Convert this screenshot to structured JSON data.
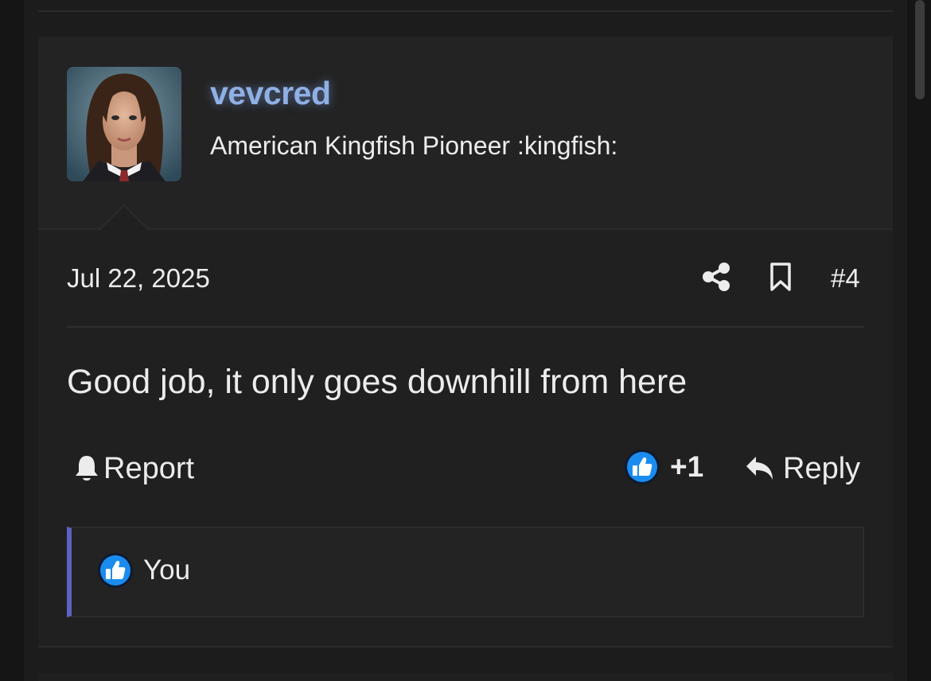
{
  "post": {
    "user": {
      "name": "vevcred",
      "title": "American Kingfish Pioneer :kingfish:"
    },
    "date": "Jul 22, 2025",
    "number": "#4",
    "body": "Good job, it only goes downhill from here",
    "actions": {
      "report_label": "Report",
      "reaction_count": "+1",
      "reply_label": "Reply"
    },
    "reactions": {
      "users": "You"
    }
  },
  "icons": {
    "share": "share-icon",
    "bookmark": "bookmark-icon",
    "bell": "bell-icon",
    "like": "thumbs-up-icon",
    "reply": "reply-arrow-icon"
  },
  "colors": {
    "username": "#8fb0e4",
    "reaction_bar_accent": "#5a63c4",
    "like_blue": "#1a8cf0"
  }
}
